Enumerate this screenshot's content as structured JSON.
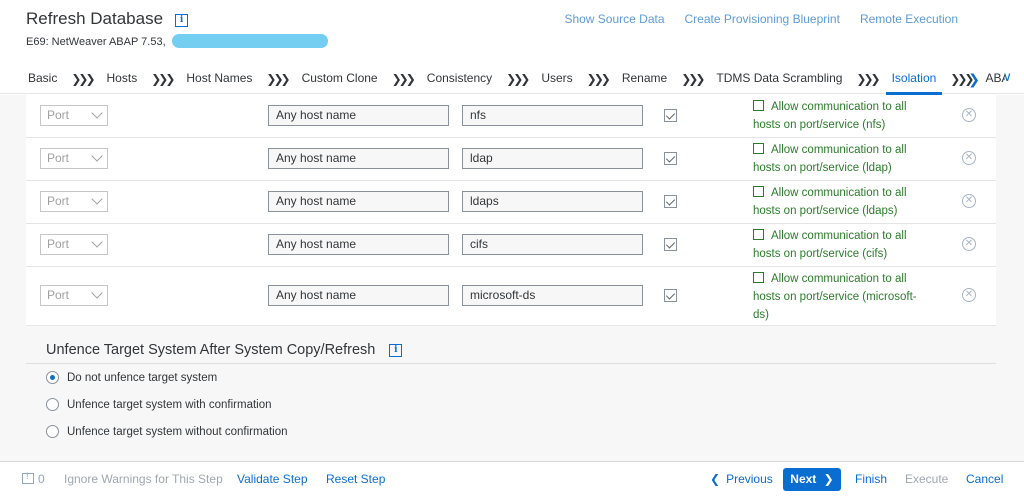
{
  "header": {
    "title": "Refresh Database",
    "info_icon": "i",
    "subtitle": "E69: NetWeaver ABAP 7.53,",
    "links": [
      "Show Source Data",
      "Create Provisioning Blueprint",
      "Remote Execution"
    ]
  },
  "tabs": {
    "items": [
      "Basic",
      "Hosts",
      "Host Names",
      "Custom Clone",
      "Consistency",
      "Users",
      "Rename",
      "TDMS Data Scrambling",
      "Isolation",
      "ABA"
    ],
    "separator": "❯❯❯",
    "scroll_icon": "❯",
    "menu_icon": "∨"
  },
  "table": {
    "rows": [
      {
        "type": "Port",
        "host": "Any host name",
        "service": "nfs",
        "allow1": "Allow communication to all",
        "allow2": "hosts on port/service (nfs)",
        "allow3": ""
      },
      {
        "type": "Port",
        "host": "Any host name",
        "service": "ldap",
        "allow1": "Allow communication to all",
        "allow2": "hosts on port/service (ldap)",
        "allow3": ""
      },
      {
        "type": "Port",
        "host": "Any host name",
        "service": "ldaps",
        "allow1": "Allow communication to all",
        "allow2": "hosts on port/service (ldaps)",
        "allow3": ""
      },
      {
        "type": "Port",
        "host": "Any host name",
        "service": "cifs",
        "allow1": "Allow communication to all",
        "allow2": "hosts on port/service (cifs)",
        "allow3": ""
      },
      {
        "type": "Port",
        "host": "Any host name",
        "service": "microsoft-ds",
        "allow1": "Allow communication to all",
        "allow2": "hosts on port/service (microsoft-",
        "allow3": "ds)"
      }
    ],
    "delete_glyph": "✕"
  },
  "unfence": {
    "title": "Unfence Target System After System Copy/Refresh",
    "options": [
      "Do not unfence target system",
      "Unfence target system with confirmation",
      "Unfence target system without confirmation"
    ],
    "selected": 0
  },
  "footer": {
    "message_count": "0",
    "ignore_warnings": "Ignore Warnings for This Step",
    "validate": "Validate Step",
    "reset": "Reset Step",
    "previous": "Previous",
    "previous_icon": "❮",
    "next": "Next",
    "next_icon": "❯",
    "finish": "Finish",
    "execute": "Execute",
    "cancel": "Cancel"
  },
  "colors": {
    "accent": "#0a6ed1",
    "link": "#5d9bd4",
    "success_text": "#2b7c2b",
    "disabled": "#a0a7b0"
  }
}
